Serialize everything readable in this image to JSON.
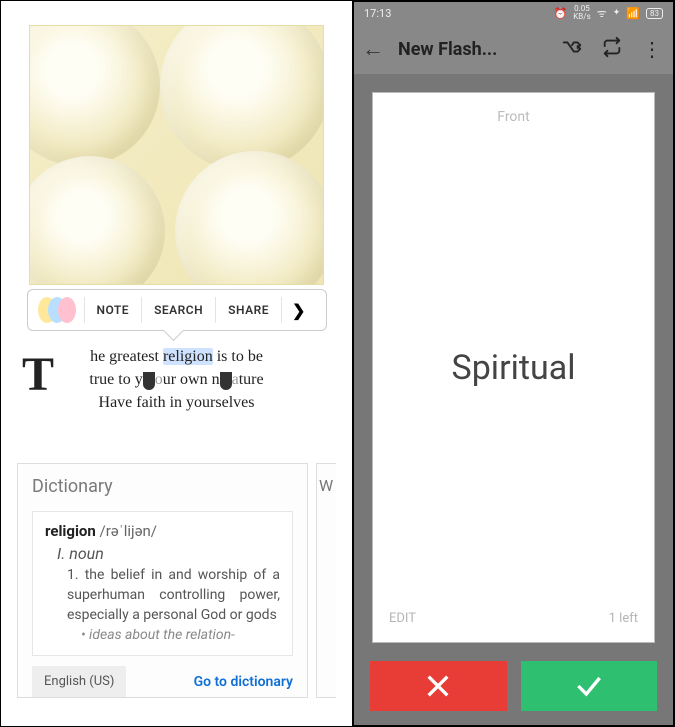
{
  "left": {
    "toolbar": {
      "note": "NOTE",
      "search": "SEARCH",
      "share": "SHARE"
    },
    "quote": {
      "dropcap": "T",
      "pre": "he greatest ",
      "highlight": "religion",
      "post1": " is to be",
      "line2a": "true to y",
      "line2b": "ur own n",
      "line2c": "ture",
      "line3": "Have faith in yourselves"
    },
    "dictionary": {
      "title": "Dictionary",
      "side_letter": "W",
      "word": "religion",
      "pron": " /rəˈlijən/",
      "pos_label": "I. noun",
      "definition": "1. the belief in and worship of a superhuman controlling power, especially a personal God or gods",
      "sub": "ideas about the relation-",
      "lang": "English (US)",
      "goto": "Go to dictionary"
    }
  },
  "right": {
    "status": {
      "time": "17:13",
      "rate": "0.05",
      "rate_unit": "KB/s"
    },
    "appbar": {
      "title": "New Flash..."
    },
    "card": {
      "side": "Front",
      "text": "Spiritual",
      "edit": "EDIT",
      "remaining": "1 left"
    }
  }
}
